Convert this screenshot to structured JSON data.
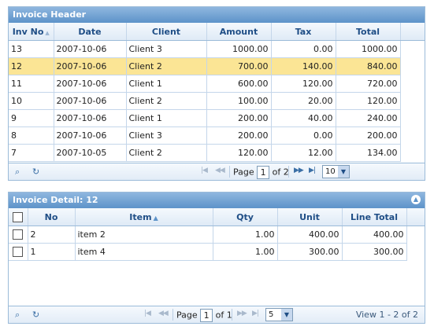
{
  "header_grid": {
    "title": "Invoice Header",
    "columns": [
      "Inv No",
      "Date",
      "Client",
      "Amount",
      "Tax",
      "Total"
    ],
    "rows": [
      [
        "13",
        "2007-10-06",
        "Client 3",
        "1000.00",
        "0.00",
        "1000.00"
      ],
      [
        "12",
        "2007-10-06",
        "Client 2",
        "700.00",
        "140.00",
        "840.00"
      ],
      [
        "11",
        "2007-10-06",
        "Client 1",
        "600.00",
        "120.00",
        "720.00"
      ],
      [
        "10",
        "2007-10-06",
        "Client 2",
        "100.00",
        "20.00",
        "120.00"
      ],
      [
        "9",
        "2007-10-06",
        "Client 1",
        "200.00",
        "40.00",
        "240.00"
      ],
      [
        "8",
        "2007-10-06",
        "Client 3",
        "200.00",
        "0.00",
        "200.00"
      ],
      [
        "7",
        "2007-10-05",
        "Client 2",
        "120.00",
        "12.00",
        "134.00"
      ]
    ],
    "selected_row_index": 1,
    "pager": {
      "page_label": "Page",
      "page_value": "1",
      "of_label": "of 2",
      "rows_per_page": "10"
    }
  },
  "detail_grid": {
    "title": "Invoice Detail: 12",
    "columns": [
      "No",
      "Item",
      "Qty",
      "Unit",
      "Line Total"
    ],
    "rows": [
      [
        "2",
        "item 2",
        "1.00",
        "400.00",
        "400.00"
      ],
      [
        "1",
        "item 4",
        "1.00",
        "300.00",
        "300.00"
      ]
    ],
    "pager": {
      "page_label": "Page",
      "page_value": "1",
      "of_label": "of 1",
      "rows_per_page": "5",
      "view_text": "View 1 - 2 of 2"
    }
  },
  "icons": {
    "search": "search-icon",
    "refresh": "refresh-icon",
    "collapse": "collapse-icon",
    "first": "first-page-icon",
    "prev": "prev-page-icon",
    "next": "next-page-icon",
    "last": "last-page-icon"
  },
  "colors": {
    "caption_top": "#8fb7df",
    "caption_bottom": "#5d93c9",
    "header_text": "#1f4e86",
    "selected_row": "#fbe595",
    "border": "#9bbbd9"
  }
}
